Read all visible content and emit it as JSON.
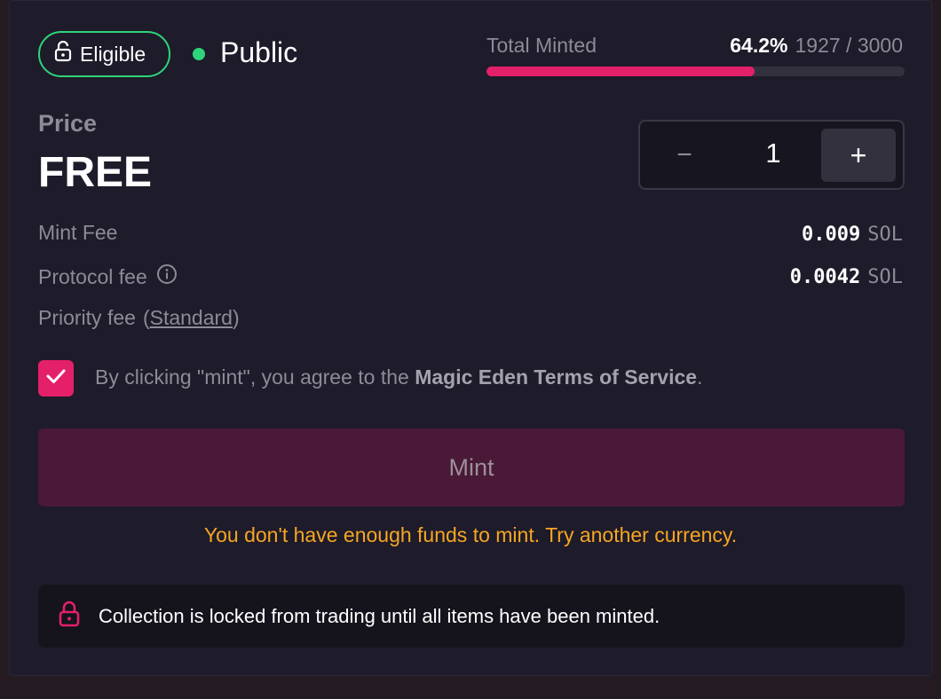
{
  "status": {
    "eligible_label": "Eligible",
    "phase": "Public",
    "dot_color": "#2ed47a"
  },
  "minted": {
    "label": "Total Minted",
    "percent": "64.2%",
    "counts": "1927 / 3000",
    "fraction": 0.642,
    "bar_color": "#e4206a"
  },
  "price": {
    "label": "Price",
    "value": "FREE"
  },
  "quantity": {
    "minus": "−",
    "value": "1",
    "plus": "+"
  },
  "fees": {
    "mint_fee_label": "Mint Fee",
    "mint_fee_amount": "0.009",
    "mint_fee_unit": "SOL",
    "protocol_fee_label": "Protocol fee",
    "protocol_fee_amount": "0.0042",
    "protocol_fee_unit": "SOL",
    "priority_fee_label": "Priority fee",
    "priority_fee_open": "(",
    "priority_fee_link": "Standard",
    "priority_fee_close": ")"
  },
  "terms": {
    "prefix": "By clicking \"mint\", you agree to the ",
    "link": "Magic Eden Terms of Service",
    "suffix": "."
  },
  "mint_button": "Mint",
  "warning": "You don't have enough funds to mint. Try another currency.",
  "notice": "Collection is locked from trading until all items have been minted."
}
